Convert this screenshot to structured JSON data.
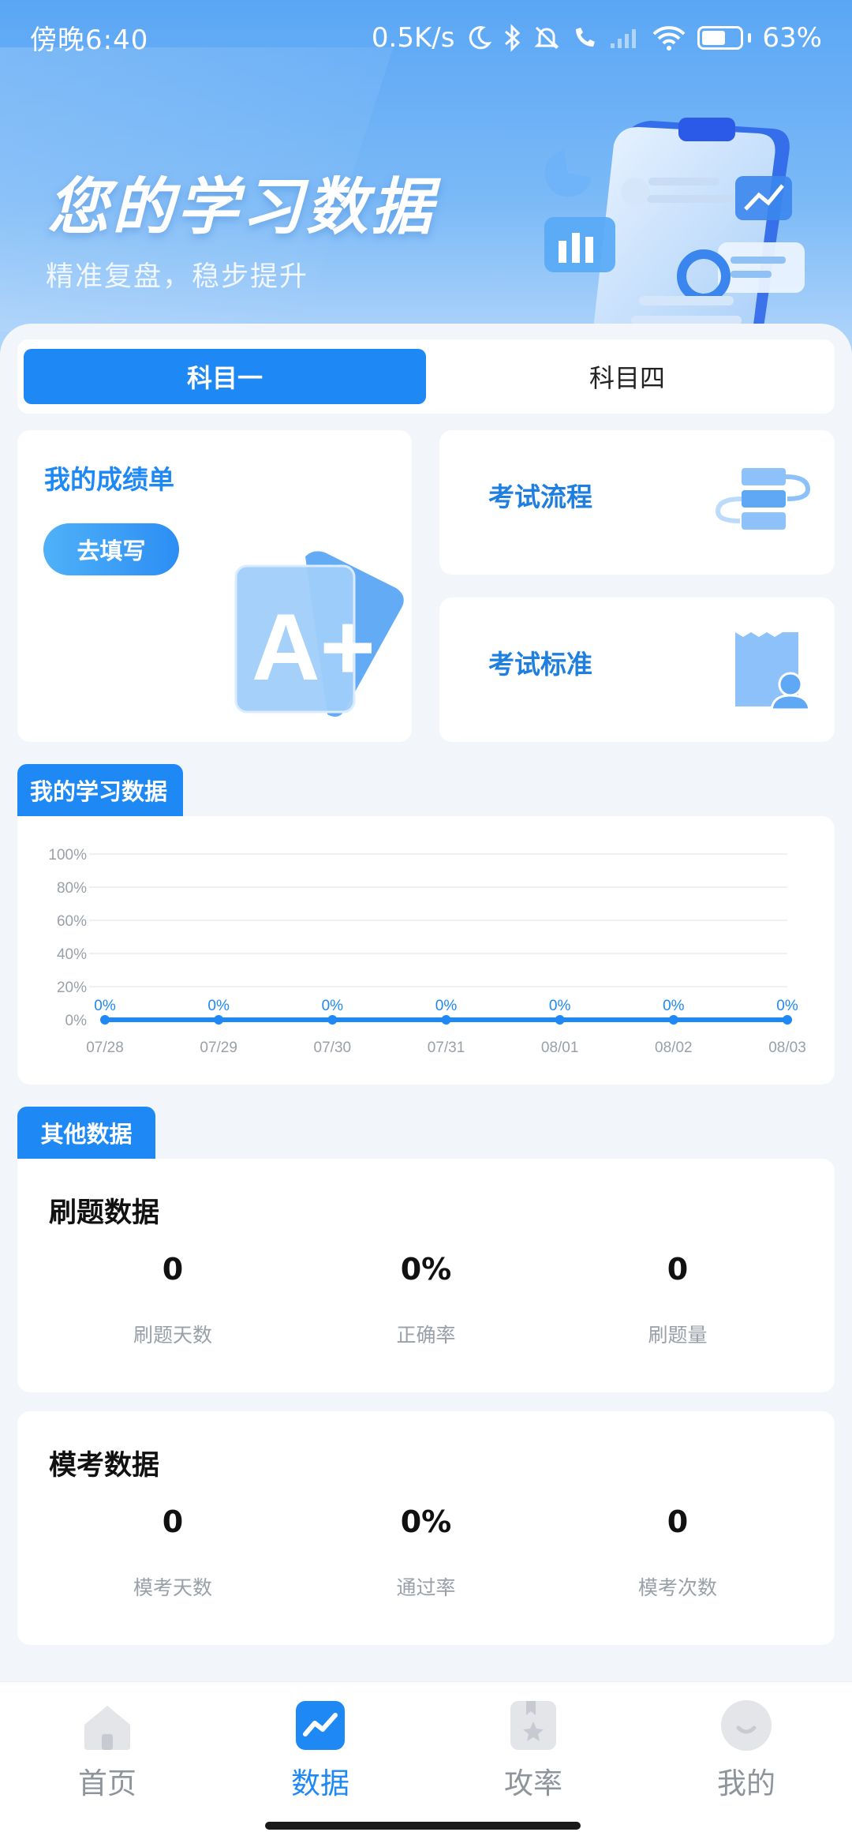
{
  "status_bar": {
    "time": "傍晚6:40",
    "net_speed": "0.5K/s",
    "battery": "63%"
  },
  "hero": {
    "title": "您的学习数据",
    "subtitle": "精准复盘，稳步提升"
  },
  "subject_tabs": [
    "科目一",
    "科目四"
  ],
  "active_subject": 0,
  "score_card": {
    "title": "我的成绩单",
    "button": "去填写",
    "badge_text": "A+"
  },
  "side_cards": {
    "flow": "考试流程",
    "standard": "考试标准"
  },
  "study_section": {
    "tag": "我的学习数据"
  },
  "chart_data": {
    "type": "line",
    "title": "",
    "xlabel": "",
    "ylabel": "",
    "categories": [
      "07/28",
      "07/29",
      "07/30",
      "07/31",
      "08/01",
      "08/02",
      "08/03"
    ],
    "series": [
      {
        "values": [
          0,
          0,
          0,
          0,
          0,
          0,
          0
        ]
      }
    ],
    "data_labels": [
      "0%",
      "0%",
      "0%",
      "0%",
      "0%",
      "0%",
      "0%"
    ],
    "yticks": [
      "0%",
      "20%",
      "40%",
      "60%",
      "80%",
      "100%"
    ],
    "ylim": [
      0,
      100
    ],
    "grid": true,
    "line_color": "#1e88f5"
  },
  "other_section": {
    "tag": "其他数据",
    "practice": {
      "title": "刷题数据",
      "stats": [
        {
          "value": "0",
          "label": "刷题天数"
        },
        {
          "value": "0%",
          "label": "正确率"
        },
        {
          "value": "0",
          "label": "刷题量"
        }
      ]
    },
    "mock": {
      "title": "模考数据",
      "stats": [
        {
          "value": "0",
          "label": "模考天数"
        },
        {
          "value": "0%",
          "label": "通过率"
        },
        {
          "value": "0",
          "label": "模考次数"
        }
      ]
    }
  },
  "bottom_nav": [
    {
      "label": "首页",
      "icon": "home-icon"
    },
    {
      "label": "数据",
      "icon": "chart-icon"
    },
    {
      "label": "攻率",
      "icon": "bookmark-star-icon"
    },
    {
      "label": "我的",
      "icon": "profile-icon"
    }
  ],
  "active_nav": 1,
  "colors": {
    "accent": "#1e88f5",
    "background": "#f2f5fa"
  }
}
